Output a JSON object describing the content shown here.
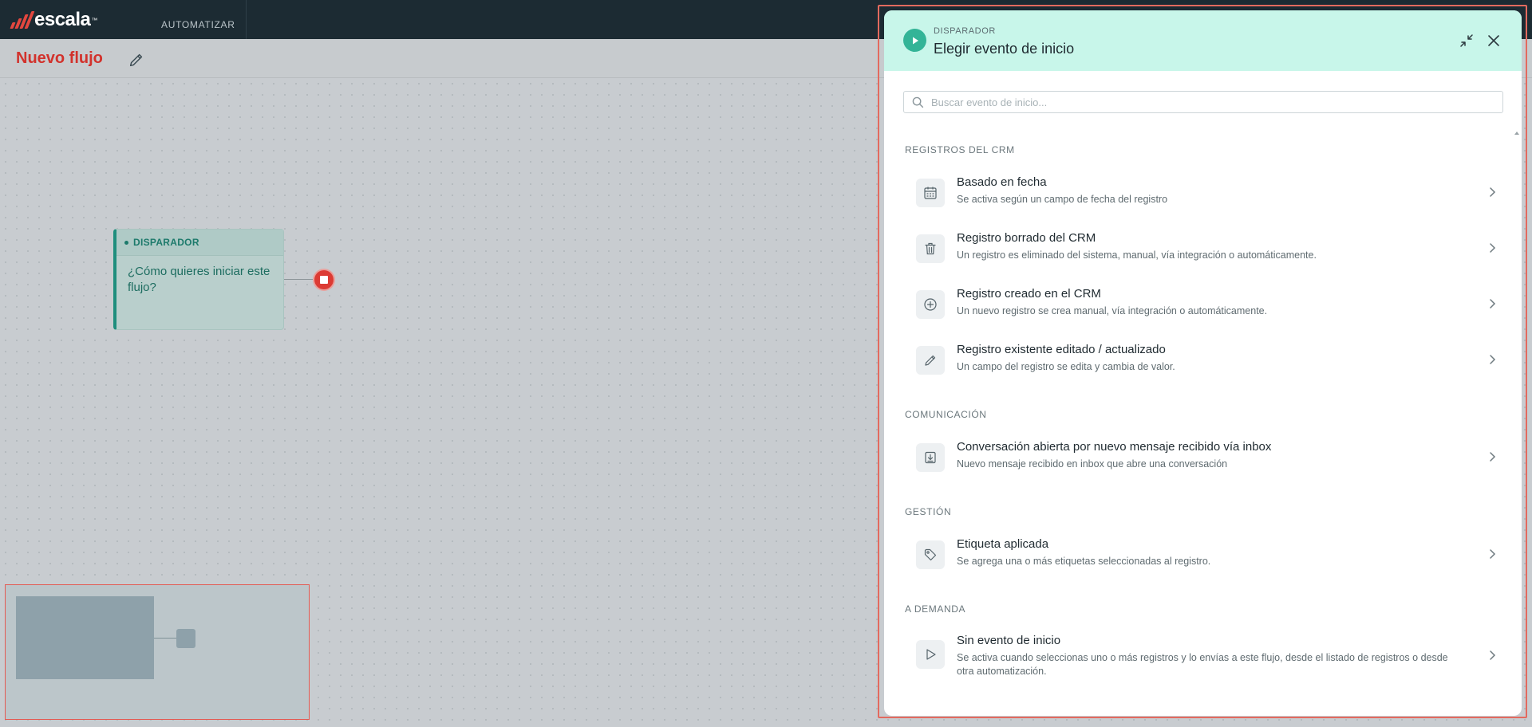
{
  "app": {
    "logo_text": "escala",
    "logo_tm": "™",
    "nav_label": "AUTOMATIZAR"
  },
  "page": {
    "title": "Nuevo flujo"
  },
  "canvas": {
    "trigger_node": {
      "label": "DISPARADOR",
      "text": "¿Cómo quieres iniciar este flujo?"
    }
  },
  "panel": {
    "kicker": "DISPARADOR",
    "title": "Elegir evento de inicio",
    "search_placeholder": "Buscar evento de inicio...",
    "sections": [
      {
        "title": "REGISTROS DEL CRM",
        "items": [
          {
            "icon": "calendar-icon",
            "title": "Basado en fecha",
            "desc": "Se activa según un campo de fecha del registro"
          },
          {
            "icon": "trash-icon",
            "title": "Registro borrado del CRM",
            "desc": "Un registro es eliminado del sistema, manual, vía integración o automáticamente."
          },
          {
            "icon": "plus-circle-icon",
            "title": "Registro creado en el CRM",
            "desc": "Un nuevo registro se crea manual, vía integración o automáticamente."
          },
          {
            "icon": "pencil-icon",
            "title": "Registro existente editado / actualizado",
            "desc": "Un campo del registro se edita y cambia de valor."
          }
        ]
      },
      {
        "title": "COMUNICACIÓN",
        "items": [
          {
            "icon": "inbox-download-icon",
            "title": "Conversación abierta por nuevo mensaje recibido vía inbox",
            "desc": "Nuevo mensaje recibido en inbox que abre una conversación"
          }
        ]
      },
      {
        "title": "GESTIÓN",
        "items": [
          {
            "icon": "tag-icon",
            "title": "Etiqueta aplicada",
            "desc": "Se agrega una o más etiquetas seleccionadas al registro."
          }
        ]
      },
      {
        "title": "A DEMANDA",
        "items": [
          {
            "icon": "play-outline-icon",
            "title": "Sin evento de inicio",
            "desc": "Se activa cuando seleccionas uno o más registros y lo envías a este flujo, desde el listado de registros o desde otra automatización."
          }
        ]
      }
    ]
  },
  "colors": {
    "brand_red": "#d2322c",
    "topbar": "#1c2b33",
    "teal": "#33b497",
    "panel_header": "#c8f6ea"
  }
}
